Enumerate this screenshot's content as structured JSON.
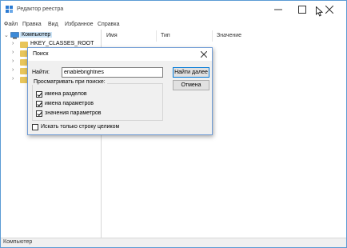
{
  "window": {
    "title": "Редактор реестра"
  },
  "menu": [
    "Файл",
    "Правка",
    "Вид",
    "Избранное",
    "Справка"
  ],
  "tree": {
    "root": "Компьютер",
    "first_child": "HKEY_CLASSES_ROOT"
  },
  "list": {
    "columns": [
      "Имя",
      "Тип",
      "Значение"
    ]
  },
  "status": "Компьютер",
  "dialog": {
    "title": "Поиск",
    "find_label": "Найти:",
    "find_value": "enablebrightnes",
    "find_next_button": "Найти далее",
    "cancel_button": "Отмена",
    "group_label": "Просматривать при поиске:",
    "options": [
      {
        "label": "имена разделов",
        "checked": true
      },
      {
        "label": "имена параметров",
        "checked": true
      },
      {
        "label": "значения параметров",
        "checked": true
      }
    ],
    "whole_string": {
      "label": "Искать только строку целиком",
      "checked": false
    }
  },
  "colors": {
    "accent": "#0078d7",
    "selection": "#cce4f7",
    "folder": "#e8c55a"
  },
  "icons": [
    "regedit-icon",
    "minimize-icon",
    "maximize-icon",
    "close-icon",
    "computer-icon",
    "folder-icon",
    "chevron-right-icon",
    "chevron-down-icon",
    "checkmark-icon",
    "mouse-cursor-icon"
  ]
}
